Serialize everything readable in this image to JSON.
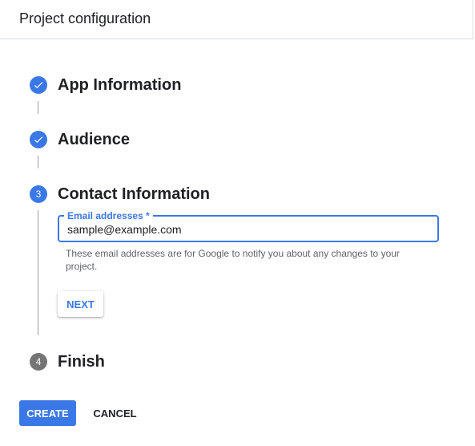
{
  "header": {
    "title": "Project configuration"
  },
  "steps": [
    {
      "number": "1",
      "title": "App Information",
      "status": "done"
    },
    {
      "number": "2",
      "title": "Audience",
      "status": "done"
    },
    {
      "number": "3",
      "title": "Contact Information",
      "status": "active"
    },
    {
      "number": "4",
      "title": "Finish",
      "status": "pending"
    }
  ],
  "contact": {
    "email_label": "Email addresses *",
    "email_value": "sample@example.com",
    "hint": "These email addresses are for Google to notify you about any changes to your project.",
    "next_label": "NEXT"
  },
  "actions": {
    "create_label": "CREATE",
    "cancel_label": "CANCEL"
  },
  "colors": {
    "accent": "#3b78e7",
    "pending": "#757575"
  }
}
